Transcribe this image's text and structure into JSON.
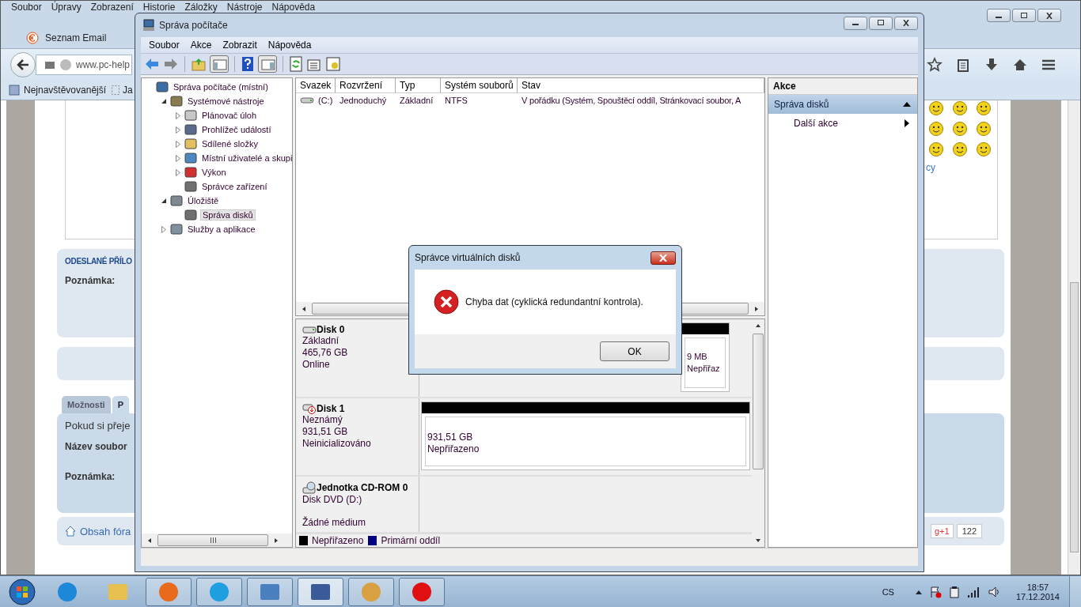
{
  "browser": {
    "menu": [
      "Soubor",
      "Úpravy",
      "Zobrazení",
      "Historie",
      "Záložky",
      "Nástroje",
      "Nápověda"
    ],
    "tab": {
      "label": "Seznam Email"
    },
    "url": "www.pc-help",
    "bookmarks": [
      "Nejnavštěvovanější",
      "Ja"
    ],
    "page": {
      "attachments_title": "ODESLANÉ PŘÍLO",
      "note_label": "Poznámka:",
      "tabs": [
        {
          "label": "Možnosti",
          "selected": false
        },
        {
          "label": "P",
          "selected": true
        }
      ],
      "intro": "Pokud si přeje",
      "file_label": "Název soubor",
      "note_label_2": "Poznámka:",
      "forum_link": "Obsah fóra",
      "side_link": "cy",
      "gplus": "g+1",
      "gplus_count": "122"
    }
  },
  "mmc": {
    "title": "Správa počítače",
    "menu": [
      "Soubor",
      "Akce",
      "Zobrazit",
      "Nápověda"
    ],
    "tree": [
      {
        "label": "Správa počítače (místní)",
        "kind": "computer",
        "selected": false,
        "children": [
          {
            "label": "Systémové nástroje",
            "kind": "tools",
            "expanded": true,
            "selected": false,
            "children": [
              {
                "label": "Plánovač úloh",
                "kind": "clock",
                "expanded": false,
                "selected": false
              },
              {
                "label": "Prohlížeč událostí",
                "kind": "log",
                "expanded": false,
                "selected": false
              },
              {
                "label": "Sdílené složky",
                "kind": "folder",
                "expanded": false,
                "selected": false
              },
              {
                "label": "Místní uživatelé a skupi",
                "kind": "users",
                "expanded": false,
                "selected": false
              },
              {
                "label": "Výkon",
                "kind": "gauge",
                "expanded": false,
                "selected": false
              },
              {
                "label": "Správce zařízení",
                "kind": "device",
                "selected": false
              }
            ]
          },
          {
            "label": "Úložiště",
            "kind": "storage",
            "expanded": true,
            "selected": false,
            "children": [
              {
                "label": "Správa disků",
                "kind": "disk",
                "selected": true
              }
            ]
          },
          {
            "label": "Služby a aplikace",
            "kind": "services",
            "expanded": false,
            "selected": false
          }
        ]
      }
    ],
    "volumes": {
      "columns": [
        "Svazek",
        "Rozvržení",
        "Typ",
        "Systém souborů",
        "Stav"
      ],
      "rows": [
        [
          "(C:)",
          "Jednoduchý",
          "Základní",
          "NTFS",
          "V pořádku (Systém, Spouštěcí oddíl, Stránkovací soubor, A"
        ]
      ]
    },
    "disks": [
      {
        "kind": "basic",
        "name": "Disk 0",
        "type": "Základní",
        "size": "465,76 GB",
        "status": "Online",
        "partitions": [
          {
            "kind": "unallocated",
            "size": "9 MB",
            "label": "Nepřiřaz"
          }
        ]
      },
      {
        "kind": "unknown",
        "name": "Disk 1",
        "type": "Neznámý",
        "size": "931,51 GB",
        "status": "Neinicializováno",
        "partitions": [
          {
            "kind": "unallocated",
            "size": "931,51 GB",
            "label": "Nepřiřazeno"
          }
        ]
      },
      {
        "kind": "cdrom",
        "name": "Jednotka CD-ROM 0",
        "type": "Disk DVD (D:)",
        "status": "Žádné médium"
      }
    ],
    "legend": [
      {
        "label": "Nepřiřazeno",
        "color": "#000000"
      },
      {
        "label": "Primární oddíl",
        "color": "#000080"
      }
    ],
    "actions": {
      "title": "Akce",
      "sections": [
        {
          "label": "Správa disků",
          "expanded": true,
          "items": [
            {
              "label": "Další akce"
            }
          ]
        }
      ]
    }
  },
  "dialog": {
    "title": "Správce virtuálních disků",
    "message": "Chyba dat (cyklická redundantní kontrola).",
    "button": "OK"
  },
  "taskbar": {
    "items": [
      {
        "kind": "ie",
        "running": false,
        "selected": false
      },
      {
        "kind": "explorer",
        "running": false,
        "selected": false
      },
      {
        "kind": "firefox",
        "running": true,
        "selected": false
      },
      {
        "kind": "skype",
        "running": true,
        "selected": false
      },
      {
        "kind": "control",
        "running": true,
        "selected": false
      },
      {
        "kind": "mmc",
        "running": true,
        "selected": true
      },
      {
        "kind": "paint",
        "running": true,
        "selected": false
      },
      {
        "kind": "splat",
        "running": true,
        "selected": false
      }
    ],
    "language": "CS",
    "time": "18:57",
    "date": "17.12.2014"
  }
}
